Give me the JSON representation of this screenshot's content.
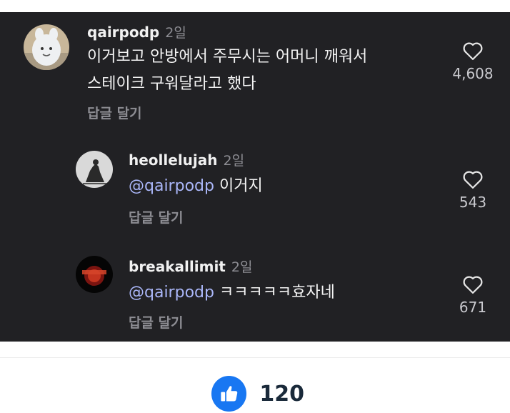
{
  "comments": [
    {
      "username": "qairpodp",
      "time": "2일",
      "text_line1": "이거보고 안방에서 주무시는 어머니 깨워서",
      "text_line2": "스테이크 구워달라고 했다",
      "reply_label": "답글 달기",
      "likes": "4,608",
      "icon": "heart-outline"
    },
    {
      "username": "heollelujah",
      "time": "2일",
      "mention": "@qairpodp",
      "text": " 이거지",
      "reply_label": "답글 달기",
      "likes": "543",
      "icon": "heart-outline"
    },
    {
      "username": "breakallimit",
      "time": "2일",
      "mention": "@qairpodp",
      "text": " ㅋㅋㅋㅋㅋ효자네",
      "reply_label": "답글 달기",
      "likes": "671",
      "icon": "heart-outline"
    }
  ],
  "footer": {
    "like_count": "120",
    "icon": "thumbs-up",
    "accent": "#1877f2"
  },
  "colors": {
    "panel_bg": "#212124",
    "mention": "#aab6f8"
  }
}
